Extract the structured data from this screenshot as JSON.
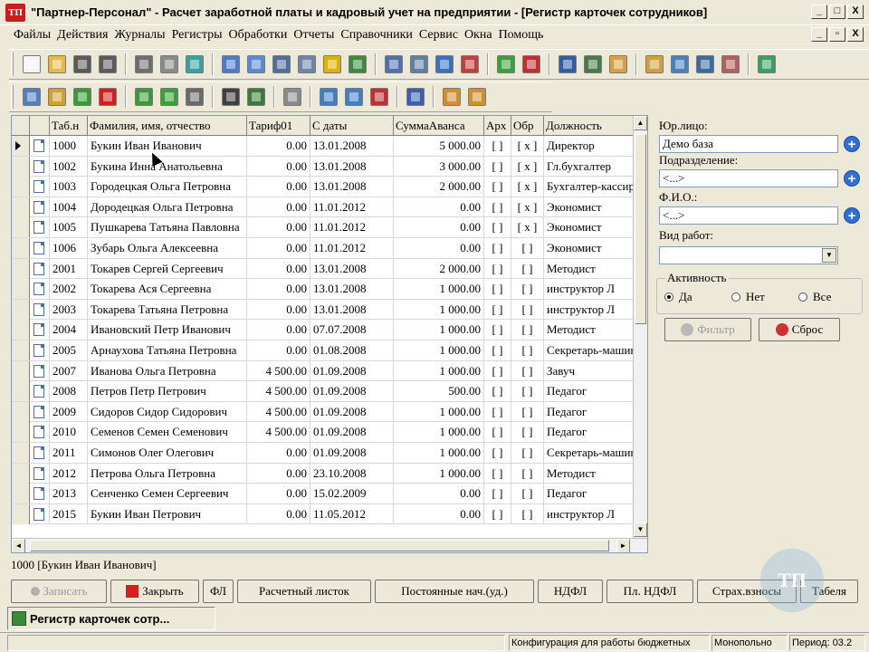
{
  "window": {
    "logo": "ТП",
    "title": "\"Партнер-Персонал\" - Расчет заработной платы и кадровый учет на предприятии - [Регистр карточек сотрудников]",
    "controls": [
      "_",
      "□",
      "X"
    ],
    "mdi_controls": [
      "_",
      "▫",
      "X"
    ]
  },
  "menu": [
    "Файлы",
    "Действия",
    "Журналы",
    "Регистры",
    "Обработки",
    "Отчеты",
    "Справочники",
    "Сервис",
    "Окна",
    "Помощь"
  ],
  "toolbar1_icons": [
    {
      "name": "new-doc-icon",
      "color": "#F4F4F4"
    },
    {
      "name": "open-folder-icon",
      "color": "#E8B84A"
    },
    {
      "name": "save-icon",
      "color": "#5A5A5A"
    },
    {
      "name": "save-all-icon",
      "color": "#5A5A5A"
    },
    {
      "name": "preview-icon",
      "color": "#6E6E6E"
    },
    {
      "name": "print-icon",
      "color": "#8A8A8A"
    },
    {
      "name": "export-icon",
      "color": "#3BA0A0"
    },
    {
      "name": "calculator-icon",
      "color": "#4B7BC8"
    },
    {
      "name": "calendar-icon",
      "color": "#5A8AD0"
    },
    {
      "name": "monitor-icon",
      "color": "#4F6E9A"
    },
    {
      "name": "tools-icon",
      "color": "#6D86A8"
    },
    {
      "name": "lock-icon",
      "color": "#E0B000"
    },
    {
      "name": "text-format-icon",
      "color": "#3C8A3C"
    },
    {
      "name": "users-icon",
      "color": "#5070B0"
    },
    {
      "name": "contacts-icon",
      "color": "#6080A0"
    },
    {
      "name": "add-user-icon",
      "color": "#3A70C0"
    },
    {
      "name": "remove-user-icon",
      "color": "#C04040"
    },
    {
      "name": "send-icon",
      "color": "#3AA03A"
    },
    {
      "name": "sort-icon",
      "color": "#C03030"
    },
    {
      "name": "person-icon",
      "color": "#2F5FA0"
    },
    {
      "name": "person-card-icon",
      "color": "#4A7A4A"
    },
    {
      "name": "photo-icon",
      "color": "#D8A040"
    },
    {
      "name": "folders-icon",
      "color": "#D0A040"
    },
    {
      "name": "table-icon",
      "color": "#4A80C0"
    },
    {
      "name": "person-search-icon",
      "color": "#3A6AA0"
    },
    {
      "name": "grid-icon",
      "color": "#B06060"
    },
    {
      "name": "settings-icon",
      "color": "#3AA060"
    }
  ],
  "toolbar2_icons": [
    {
      "name": "go-record-icon",
      "color": "#5080C0"
    },
    {
      "name": "edit-icon",
      "color": "#D0A030"
    },
    {
      "name": "copy-icon",
      "color": "#3A9A3A"
    },
    {
      "name": "delete-icon",
      "color": "#D02020"
    },
    {
      "name": "tree-icon",
      "color": "#3A9A3A"
    },
    {
      "name": "refresh-icon",
      "color": "#3AA03A"
    },
    {
      "name": "window-icon",
      "color": "#6A6A6A"
    },
    {
      "name": "binoculars-icon",
      "color": "#404040"
    },
    {
      "name": "binoculars-next-icon",
      "color": "#3A7A3A"
    },
    {
      "name": "print-icon",
      "color": "#8A8A8A"
    },
    {
      "name": "filter-icon",
      "color": "#4080C0"
    },
    {
      "name": "filter-edit-icon",
      "color": "#4080C0"
    },
    {
      "name": "filter-clear-icon",
      "color": "#C03030"
    },
    {
      "name": "help-icon",
      "color": "#3A60B0"
    },
    {
      "name": "pen-icon",
      "color": "#D09030"
    },
    {
      "name": "pen-doc-icon",
      "color": "#D09030"
    }
  ],
  "grid": {
    "columns": [
      "",
      "",
      "Таб.н",
      "Фамилия, имя, отчество",
      "Тариф01",
      "С даты",
      "СуммаАванса",
      "Арх",
      "Обр",
      "Должность"
    ],
    "rows": [
      {
        "tab": "1000",
        "name": "Букин Иван Иванович",
        "tariff": "0.00",
        "date": "13.01.2008",
        "advance": "5 000.00",
        "arch": "[ ]",
        "obr": "[ x ]",
        "position": "Директор",
        "current": true
      },
      {
        "tab": "1002",
        "name": "Букина Инна Анатольевна",
        "tariff": "0.00",
        "date": "13.01.2008",
        "advance": "3 000.00",
        "arch": "[ ]",
        "obr": "[ x ]",
        "position": "Гл.бухгалтер"
      },
      {
        "tab": "1003",
        "name": "Городецкая Ольга Петровна",
        "tariff": "0.00",
        "date": "13.01.2008",
        "advance": "2 000.00",
        "arch": "[ ]",
        "obr": "[ x ]",
        "position": "Бухгалтер-кассир"
      },
      {
        "tab": "1004",
        "name": "Дородецкая Ольга Петровна",
        "tariff": "0.00",
        "date": "11.01.2012",
        "advance": "0.00",
        "arch": "[ ]",
        "obr": "[ x ]",
        "position": "Экономист"
      },
      {
        "tab": "1005",
        "name": "Пушкарева Татьяна Павловна",
        "tariff": "0.00",
        "date": "11.01.2012",
        "advance": "0.00",
        "arch": "[ ]",
        "obr": "[ x ]",
        "position": "Экономист"
      },
      {
        "tab": "1006",
        "name": "Зубарь Ольга Алексеевна",
        "tariff": "0.00",
        "date": "11.01.2012",
        "advance": "0.00",
        "arch": "[ ]",
        "obr": "[ ]",
        "position": "Экономист"
      },
      {
        "tab": "2001",
        "name": "Токарев Сергей Сергеевич",
        "tariff": "0.00",
        "date": "13.01.2008",
        "advance": "2 000.00",
        "arch": "[ ]",
        "obr": "[ ]",
        "position": "Методист"
      },
      {
        "tab": "2002",
        "name": "Токарева Ася Сергеевна",
        "tariff": "0.00",
        "date": "13.01.2008",
        "advance": "1 000.00",
        "arch": "[ ]",
        "obr": "[ ]",
        "position": "инструктор Л"
      },
      {
        "tab": "2003",
        "name": "Токарева Татьяна Петровна",
        "tariff": "0.00",
        "date": "13.01.2008",
        "advance": "1 000.00",
        "arch": "[ ]",
        "obr": "[ ]",
        "position": "инструктор Л"
      },
      {
        "tab": "2004",
        "name": "Ивановский Петр Иванович",
        "tariff": "0.00",
        "date": "07.07.2008",
        "advance": "1 000.00",
        "arch": "[ ]",
        "obr": "[ ]",
        "position": "Методист"
      },
      {
        "tab": "2005",
        "name": "Арнаухова Татьяна Петровна",
        "tariff": "0.00",
        "date": "01.08.2008",
        "advance": "1 000.00",
        "arch": "[ ]",
        "obr": "[ ]",
        "position": "Секретарь-машинистка"
      },
      {
        "tab": "2007",
        "name": "Иванова Ольга Петровна",
        "tariff": "4 500.00",
        "date": "01.09.2008",
        "advance": "1 000.00",
        "arch": "[ ]",
        "obr": "[ ]",
        "position": "Завуч"
      },
      {
        "tab": "2008",
        "name": "Петров Петр Петрович",
        "tariff": "4 500.00",
        "date": "01.09.2008",
        "advance": "500.00",
        "arch": "[ ]",
        "obr": "[ ]",
        "position": "Педагог"
      },
      {
        "tab": "2009",
        "name": "Сидоров Сидор Сидорович",
        "tariff": "4 500.00",
        "date": "01.09.2008",
        "advance": "1 000.00",
        "arch": "[ ]",
        "obr": "[ ]",
        "position": "Педагог"
      },
      {
        "tab": "2010",
        "name": "Семенов Семен Семенович",
        "tariff": "4 500.00",
        "date": "01.09.2008",
        "advance": "1 000.00",
        "arch": "[ ]",
        "obr": "[ ]",
        "position": "Педагог"
      },
      {
        "tab": "2011",
        "name": "Симонов Олег Олегович",
        "tariff": "0.00",
        "date": "01.09.2008",
        "advance": "1 000.00",
        "arch": "[ ]",
        "obr": "[ ]",
        "position": "Секретарь-машинистка"
      },
      {
        "tab": "2012",
        "name": "Петрова Ольга Петровна",
        "tariff": "0.00",
        "date": "23.10.2008",
        "advance": "1 000.00",
        "arch": "[ ]",
        "obr": "[ ]",
        "position": "Методист"
      },
      {
        "tab": "2013",
        "name": "Сенченко Семен Сергеевич",
        "tariff": "0.00",
        "date": "15.02.2009",
        "advance": "0.00",
        "arch": "[ ]",
        "obr": "[ ]",
        "position": "Педагог"
      },
      {
        "tab": "2015",
        "name": "Букин Иван Петрович",
        "tariff": "0.00",
        "date": "11.05.2012",
        "advance": "0.00",
        "arch": "[ ]",
        "obr": "[ ]",
        "position": "инструктор Л"
      }
    ]
  },
  "filter": {
    "org_label": "Юр.лицо:",
    "org_value": "Демо база",
    "dept_label": "Подразделение:",
    "dept_value": "<...>",
    "fio_label": "Ф.И.О.:",
    "fio_value": "<...>",
    "worktype_label": "Вид работ:",
    "worktype_value": "",
    "activity_title": "Активность",
    "radio_yes": "Да",
    "radio_no": "Нет",
    "radio_all": "Все",
    "plus": "+",
    "filter_btn": "Фильтр",
    "reset_btn": "Сброс"
  },
  "status_record": "1000 [Букин Иван Иванович]",
  "bottom_buttons": {
    "save": "Записать",
    "close": "Закрыть",
    "fl": "ФЛ",
    "payslip": "Расчетный листок",
    "permanent": "Постоянные нач.(уд.)",
    "ndfl": "НДФЛ",
    "pl_ndfl": "Пл. НДФЛ",
    "insurance": "Страх.взносы",
    "timesheet": "Табеля"
  },
  "taskbar_item": "Регистр карточек сотр...",
  "statusbar": {
    "config": "Конфигурация для работы бюджетных",
    "mode": "Монопольно",
    "period": "Период: 03.2"
  },
  "watermark": "ТП",
  "colors": {
    "accent_blue": "#2F6FD6",
    "logo_red": "#C81E1E",
    "window_bg": "#ECE9D8"
  }
}
